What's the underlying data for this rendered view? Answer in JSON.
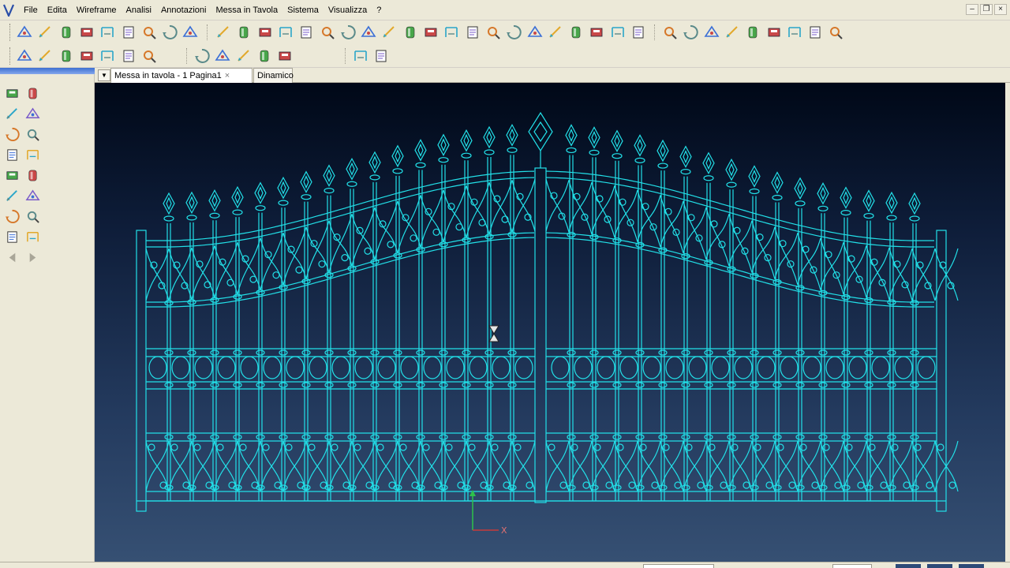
{
  "menubar": {
    "items": [
      "File",
      "Edita",
      "Wireframe",
      "Analisi",
      "Annotazioni",
      "Messa in Tavola",
      "Sistema",
      "Visualizza",
      "?"
    ],
    "window_controls": [
      "minimize",
      "restore",
      "close"
    ]
  },
  "tabs": {
    "active": "Messa in tavola - 1 Pagina1",
    "close_glyph": "×",
    "secondary": "Dinamico"
  },
  "viewport": {
    "axis_x_label": "X",
    "background_top": "#000817",
    "background_bottom": "#365073",
    "drawing_color": "#22e0e8",
    "cursor": "hourglass-icon"
  },
  "toolbar1": {
    "icons": [
      "new-icon",
      "open-icon",
      "open-folder-icon",
      "save-icon",
      "save-all-icon",
      "print-icon",
      "print-preview-icon",
      "zoom-icon",
      "window-icon",
      "line-icon",
      "triangle-icon",
      "dimension-icon",
      "baseline-icon",
      "list-icon",
      "list-alt-icon",
      "copy-icon",
      "frame-icon",
      "edit-icon",
      "annotation-icon",
      "abc-icon",
      "stamp-icon",
      "angle-icon",
      "fork-icon",
      "search-icon",
      "crosshair-icon",
      "pencil-box-icon",
      "gear-icon",
      "gear-arrow-icon",
      "document-edit-icon",
      "magnify-icon",
      "bucket-icon",
      "shapes-icon",
      "arrow-right-icon",
      "refresh-icon",
      "scissors-icon",
      "trim-icon",
      "extend-icon",
      "align-icon",
      "pin-icon"
    ]
  },
  "toolbar2": {
    "icons": [
      "tool-a-icon",
      "tool-b-icon",
      "tool-c-icon",
      "tool-d-icon",
      "tool-e-icon",
      "tool-f-icon",
      "tool-g-icon",
      "cylinder-icon",
      "column-icon",
      "barrel-icon",
      "grid-icon",
      "pattern-icon",
      "undo-icon",
      "redo-icon"
    ]
  },
  "left_panel": {
    "icons": [
      "view-icon",
      "cut-icon",
      "frame-tool-icon",
      "edit-tool-icon",
      "detail-icon",
      "note-icon",
      "palette-icon",
      "check-icon",
      "rotate-icon",
      "question-icon",
      "bucket-tool-icon",
      "swap-icon",
      "people-icon",
      "dimension-tool-icon",
      "tree-icon",
      "folder-icon",
      "back-arrow-icon",
      "forward-arrow-icon"
    ]
  }
}
